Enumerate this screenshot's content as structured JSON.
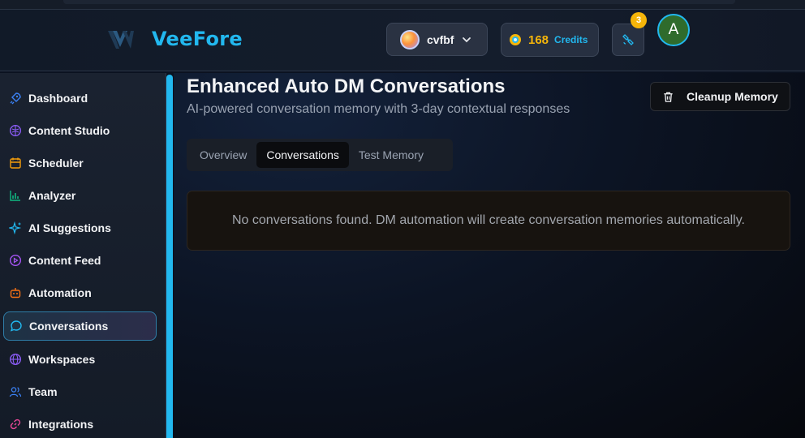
{
  "header": {
    "logo_text": "VeeFore",
    "workspace": {
      "name": "cvfbf"
    },
    "credits": {
      "amount": "168",
      "label": "Credits"
    },
    "notifications": {
      "count": "3"
    },
    "user": {
      "initial": "A"
    }
  },
  "sidebar": {
    "items": [
      {
        "label": "Dashboard",
        "icon": "rocket-icon",
        "color": "#3b82f6"
      },
      {
        "label": "Content Studio",
        "icon": "brain-icon",
        "color": "#8b5cf6"
      },
      {
        "label": "Scheduler",
        "icon": "calendar-icon",
        "color": "#f59e0b"
      },
      {
        "label": "Analyzer",
        "icon": "bar-chart-icon",
        "color": "#10b981"
      },
      {
        "label": "AI Suggestions",
        "icon": "sparkles-icon",
        "color": "#22b8ef"
      },
      {
        "label": "Content Feed",
        "icon": "play-circle-icon",
        "color": "#a855f7"
      },
      {
        "label": "Automation",
        "icon": "bot-icon",
        "color": "#f97316"
      },
      {
        "label": "Conversations",
        "icon": "message-circle-icon",
        "color": "#22b8ef",
        "active": true
      },
      {
        "label": "Workspaces",
        "icon": "globe-icon",
        "color": "#8b5cf6"
      },
      {
        "label": "Team",
        "icon": "users-icon",
        "color": "#3b82f6"
      },
      {
        "label": "Integrations",
        "icon": "link-icon",
        "color": "#ec4899"
      }
    ]
  },
  "main": {
    "title": "Enhanced Auto DM Conversations",
    "subtitle": "AI-powered conversation memory with 3-day contextual responses",
    "cleanup_label": "Cleanup Memory",
    "tabs": [
      {
        "label": "Overview"
      },
      {
        "label": "Conversations",
        "active": true
      },
      {
        "label": "Test Memory"
      }
    ],
    "empty_message": "No conversations found. DM automation will create conversation memories automatically."
  },
  "colors": {
    "accent": "#22b8ef",
    "credits": "#f5b50a",
    "background": "#0b1220"
  }
}
